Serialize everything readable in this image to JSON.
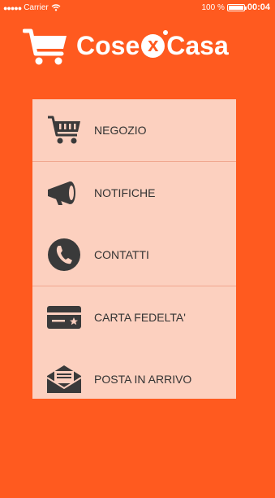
{
  "status_bar": {
    "carrier": "Carrier",
    "battery_text": "100 %",
    "battery_level": 1.0,
    "time": "00:04"
  },
  "header": {
    "brand_left": "Cose",
    "brand_mid": "x",
    "brand_right": "Casa"
  },
  "menu": {
    "items": [
      {
        "label": "NEGOZIO",
        "icon": "shopping-cart-icon"
      },
      {
        "label": "NOTIFICHE",
        "icon": "megaphone-icon"
      },
      {
        "label": "CONTATTI",
        "icon": "phone-icon"
      },
      {
        "label": "CARTA FEDELTA'",
        "icon": "loyalty-card-icon"
      },
      {
        "label": "POSTA IN ARRIVO",
        "icon": "inbox-envelope-icon"
      }
    ]
  },
  "colors": {
    "background": "#ff5a1f",
    "menu_background": "#fcd0bf",
    "icon": "#3a3a3a"
  }
}
